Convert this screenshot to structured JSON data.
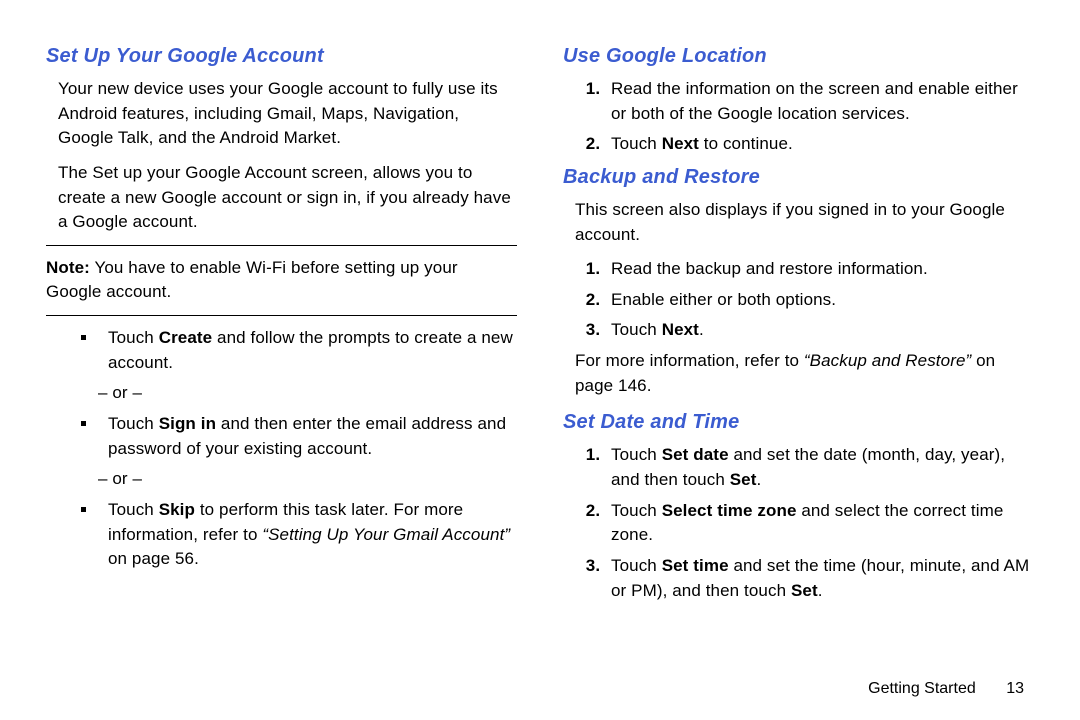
{
  "left": {
    "heading": "Set Up Your Google Account",
    "p1": "Your new device uses your Google account to fully use its Android features, including Gmail, Maps, Navigation, Google Talk, and the Android Market.",
    "p2": "The Set up your Google Account screen, allows you to create a new Google account or sign in, if you already have a Google account.",
    "note_label": "Note:",
    "note_text": " You have to enable Wi-Fi before setting up your Google account.",
    "b1_pre": "Touch ",
    "b1_bold": "Create",
    "b1_post": " and follow the prompts to create a new account.",
    "or": "– or –",
    "b2_pre": "Touch ",
    "b2_bold": "Sign in",
    "b2_post": " and then enter the email address and password of your existing account.",
    "b3_pre": "Touch ",
    "b3_bold": "Skip",
    "b3_post": " to perform this task later. For more information, refer to ",
    "b3_ref": "“Setting Up Your Gmail Account”",
    "b3_tail": " on page 56."
  },
  "right": {
    "sec1_head": "Use Google Location",
    "sec1_i1": "Read the information on the screen and enable either or both of the Google location services.",
    "sec1_i2_pre": "Touch ",
    "sec1_i2_bold": "Next",
    "sec1_i2_post": " to continue.",
    "sec2_head": "Backup and Restore",
    "sec2_intro": "This screen also displays if you signed in to your Google account.",
    "sec2_i1": "Read the backup and restore information.",
    "sec2_i2": "Enable either or both options.",
    "sec2_i3_pre": "Touch ",
    "sec2_i3_bold": "Next",
    "sec2_i3_post": ".",
    "sec2_more_pre": "For more information, refer to ",
    "sec2_more_ref": "“Backup and Restore”",
    "sec2_more_post": "  on page 146.",
    "sec3_head": "Set Date and Time",
    "sec3_i1_pre": "Touch ",
    "sec3_i1_bold": "Set date",
    "sec3_i1_mid": " and set the date (month, day, year), and then touch ",
    "sec3_i1_bold2": "Set",
    "sec3_i1_post": ".",
    "sec3_i2_pre": "Touch ",
    "sec3_i2_bold": "Select time zone",
    "sec3_i2_post": " and select the correct time zone.",
    "sec3_i3_pre": "Touch ",
    "sec3_i3_bold": "Set time",
    "sec3_i3_mid": " and set the time (hour, minute, and AM or PM), and then touch ",
    "sec3_i3_bold2": "Set",
    "sec3_i3_post": "."
  },
  "footer": {
    "section": "Getting Started",
    "page": "13"
  }
}
